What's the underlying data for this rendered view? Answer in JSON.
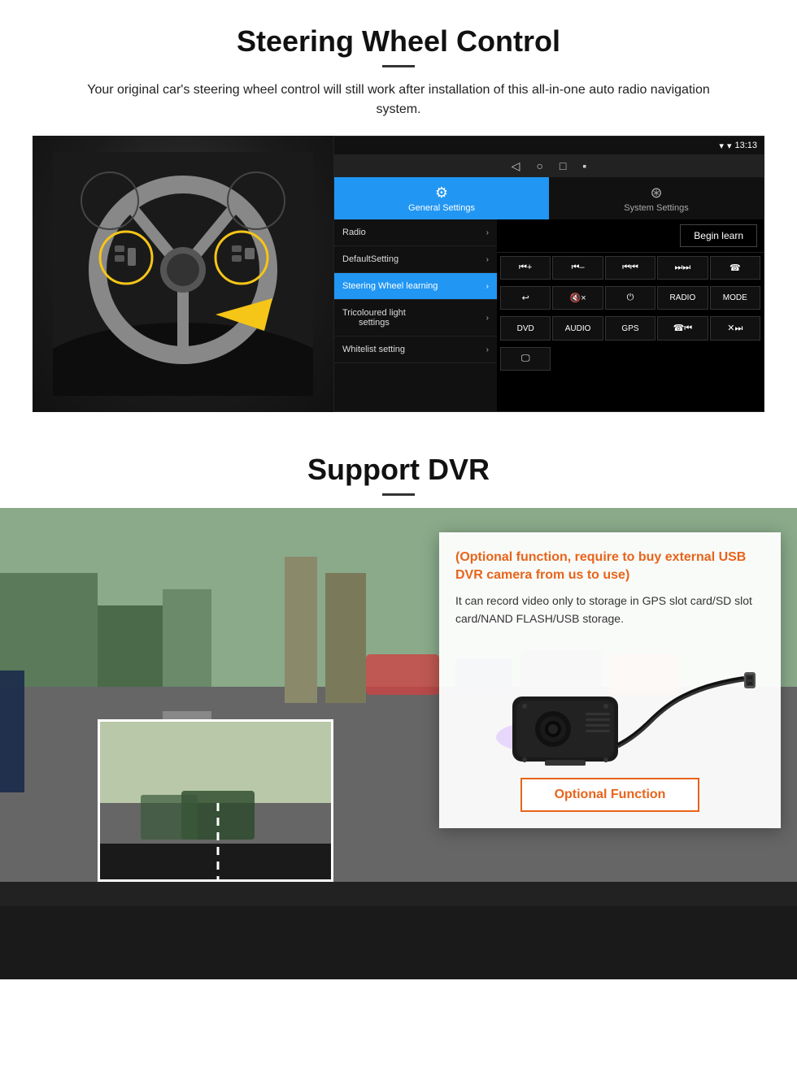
{
  "steering": {
    "title": "Steering Wheel Control",
    "description": "Your original car's steering wheel control will still work after installation of this all-in-one auto radio navigation system.",
    "statusbar": {
      "time": "13:13",
      "icons": [
        "▼",
        "▾"
      ]
    },
    "tabs": {
      "active": {
        "icon": "⚙",
        "label": "General Settings"
      },
      "inactive": {
        "icon": "⊛",
        "label": "System Settings"
      }
    },
    "menu": [
      {
        "label": "Radio",
        "active": false
      },
      {
        "label": "DefaultSetting",
        "active": false
      },
      {
        "label": "Steering Wheel learning",
        "active": true
      },
      {
        "label": "Tricoloured light settings",
        "active": false
      },
      {
        "label": "Whitelist setting",
        "active": false
      }
    ],
    "begin_learn": "Begin learn",
    "controls": [
      [
        "⏮+",
        "⏮-",
        "⏮⏮",
        "⏭⏭",
        "📞"
      ],
      [
        "↩",
        "🔇×",
        "⏻",
        "RADIO",
        "MODE"
      ],
      [
        "DVD",
        "AUDIO",
        "GPS",
        "📞⏮",
        "✕⏭⏭"
      ],
      [
        "🗒"
      ]
    ]
  },
  "dvr": {
    "title": "Support DVR",
    "optional_title": "(Optional function, require to buy external USB DVR camera from us to use)",
    "description": "It can record video only to storage in GPS slot card/SD slot card/NAND FLASH/USB storage.",
    "optional_button": "Optional Function"
  }
}
